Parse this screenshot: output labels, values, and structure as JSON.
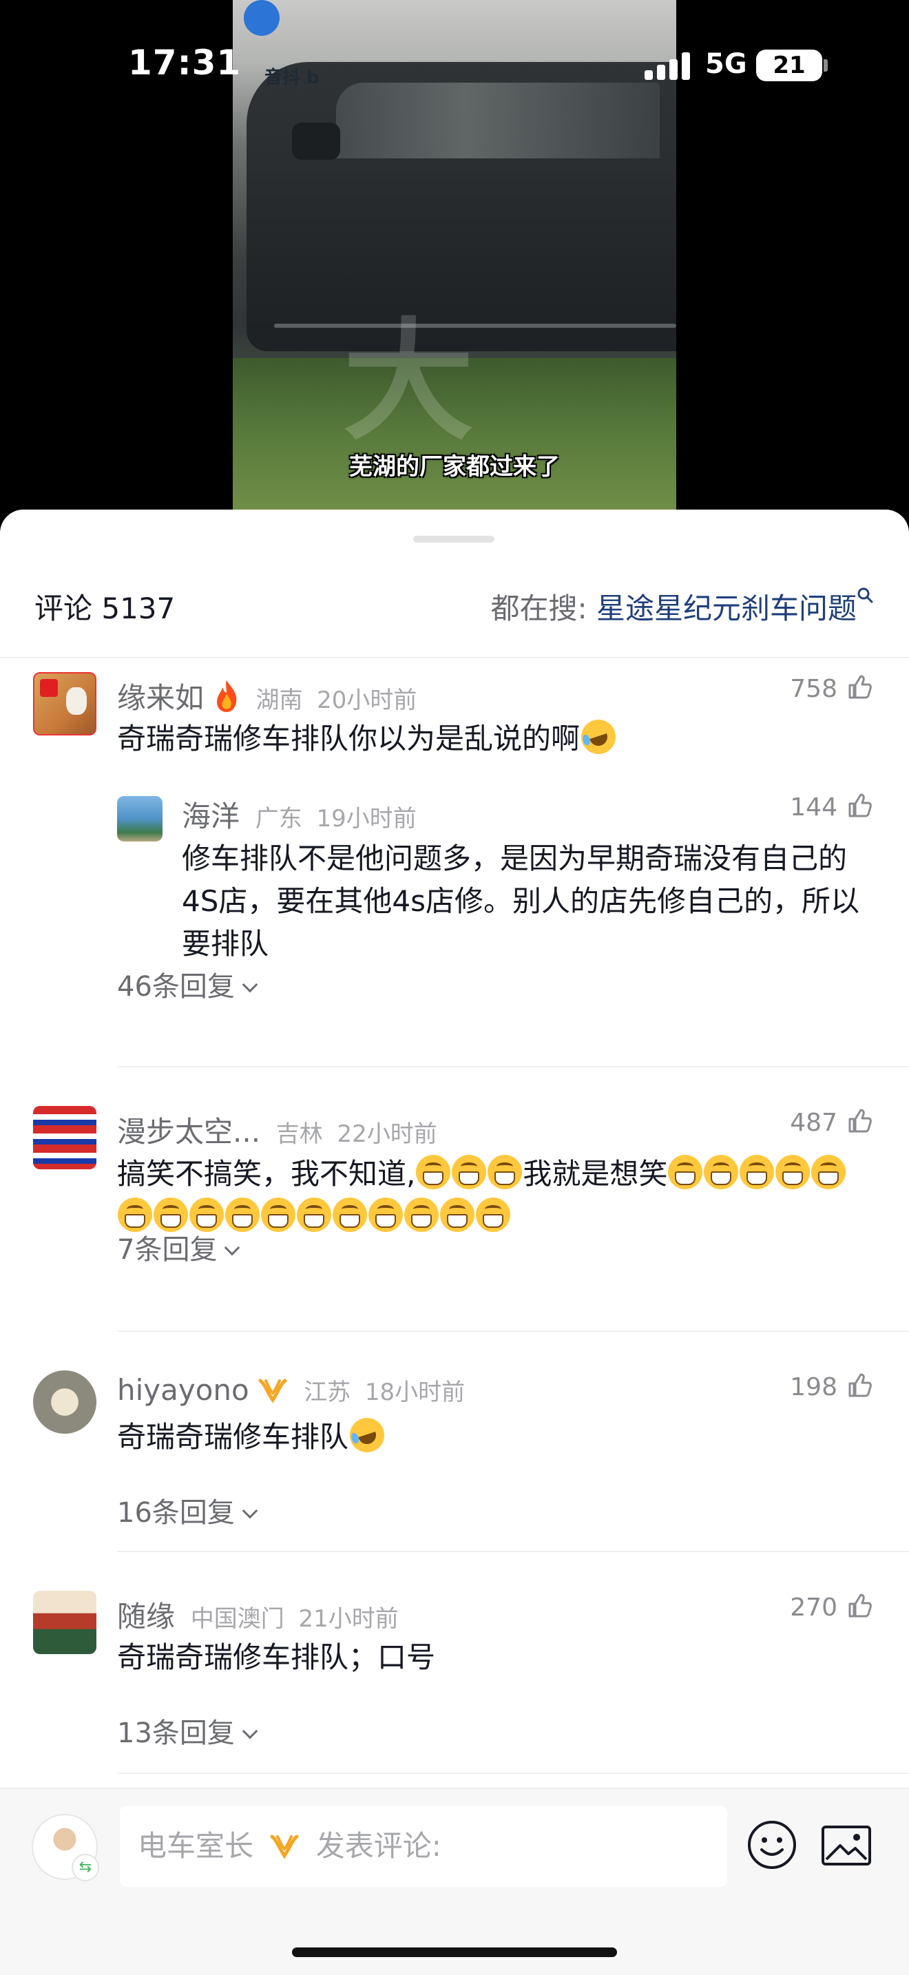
{
  "status_bar": {
    "time": "17:31",
    "network": "5G",
    "battery": "21"
  },
  "video": {
    "subtitle": "芜湖的厂家都过来了",
    "watermark": "大",
    "logo_text": "音抖 b"
  },
  "header": {
    "comment_label": "评论 5137",
    "search_prefix": "都在搜: ",
    "search_keyword": "星途星纪元刹车问题"
  },
  "comments": [
    {
      "name": "缘来如",
      "badge": "fire",
      "location": "湖南",
      "time": "20小时前",
      "likes": "758",
      "text": "奇瑞奇瑞修车排队你以为是乱说的啊",
      "reply": {
        "name": "海洋",
        "location": "广东",
        "time": "19小时前",
        "likes": "144",
        "text": "修车排队不是他问题多，是因为早期奇瑞没有自己的4S店，要在其他4s店修。别人的店先修自己的，所以要排队"
      },
      "replies_label": "46条回复"
    },
    {
      "name": "漫步太空...",
      "location": "吉林",
      "time": "22小时前",
      "likes": "487",
      "text_before": "搞笑不搞笑，我不知道,",
      "text_middle": "我就是想笑",
      "replies_label": "7条回复"
    },
    {
      "name": "hiyayono",
      "badge": "verified-w",
      "location": "江苏",
      "time": "18小时前",
      "likes": "198",
      "text": "奇瑞奇瑞修车排队",
      "replies_label": "16条回复"
    },
    {
      "name": "随缘",
      "location": "中国澳门",
      "time": "21小时前",
      "likes": "270",
      "text": "奇瑞奇瑞修车排队；口号",
      "replies_label": "13条回复"
    }
  ],
  "input_bar": {
    "user_name": "电车室长",
    "placeholder": "发表评论:",
    "icons": [
      "emoji-icon",
      "image-icon"
    ]
  },
  "colors": {
    "accent_keyword": "#1f3f7a",
    "meta": "#a6a7ab",
    "name": "#6b6c71"
  }
}
